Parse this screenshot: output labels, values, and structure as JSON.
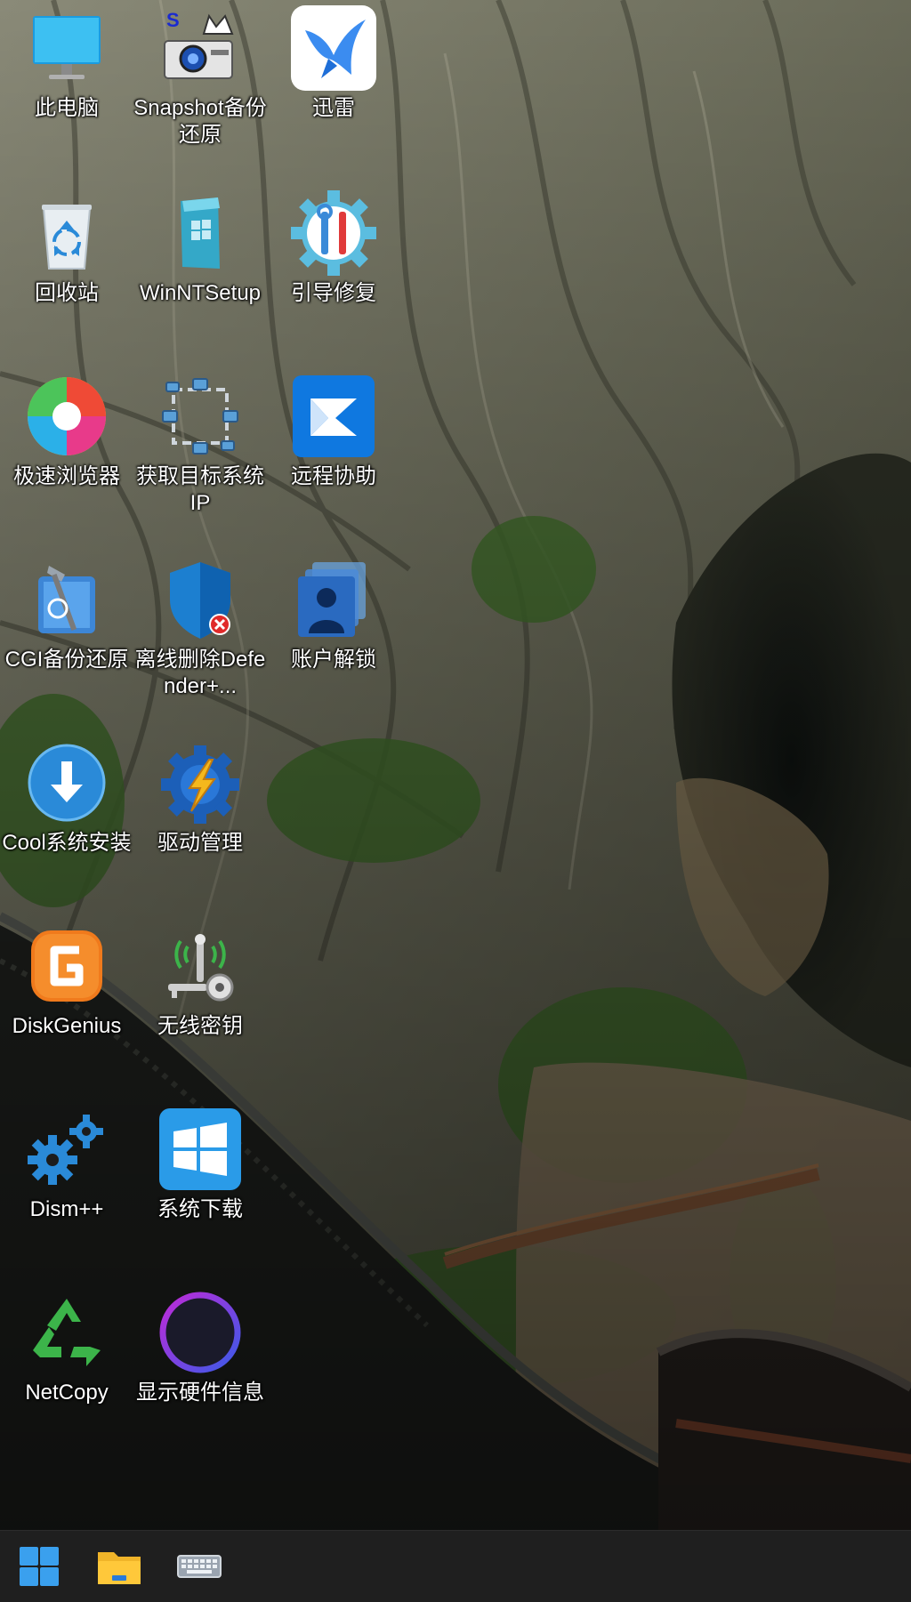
{
  "desktop": {
    "icons": [
      {
        "label": "此电脑",
        "icon": "monitor-icon"
      },
      {
        "label": "Snapshot备份还原",
        "icon": "snapshot-camera-icon"
      },
      {
        "label": "迅雷",
        "icon": "thunder-bird-icon"
      },
      {
        "label": "回收站",
        "icon": "recycle-bin-icon"
      },
      {
        "label": "WinNTSetup",
        "icon": "winntsetup-icon"
      },
      {
        "label": "引导修复",
        "icon": "boot-repair-gear-icon"
      },
      {
        "label": "极速浏览器",
        "icon": "browser-swirl-icon"
      },
      {
        "label": "获取目标系统IP",
        "icon": "network-nodes-icon"
      },
      {
        "label": "远程协助",
        "icon": "remote-assist-icon"
      },
      {
        "label": "CGI备份还原",
        "icon": "cgi-tools-icon"
      },
      {
        "label": "离线删除Defender+...",
        "icon": "defender-shield-icon"
      },
      {
        "label": "账户解锁",
        "icon": "user-accounts-icon"
      },
      {
        "label": "Cool系统安装",
        "icon": "download-arrow-circle-icon"
      },
      {
        "label": "驱动管理",
        "icon": "driver-gear-icon"
      },
      {
        "label": "DiskGenius",
        "icon": "diskgenius-icon"
      },
      {
        "label": "无线密钥",
        "icon": "wireless-key-icon"
      },
      {
        "label": "Dism++",
        "icon": "gears-icon"
      },
      {
        "label": "系统下载",
        "icon": "windows-logo-icon"
      },
      {
        "label": "NetCopy",
        "icon": "green-recycle-icon"
      },
      {
        "label": "显示硬件信息",
        "icon": "hardware-info-icon"
      }
    ]
  },
  "taskbar": {
    "items": [
      {
        "name": "start",
        "icon": "windows-start-icon"
      },
      {
        "name": "file-explorer",
        "icon": "folder-icon"
      },
      {
        "name": "on-screen-keyboard",
        "icon": "keyboard-icon"
      }
    ]
  },
  "colors": {
    "taskbar_bg": "#1f1f1f",
    "accent": "#0a74da"
  }
}
